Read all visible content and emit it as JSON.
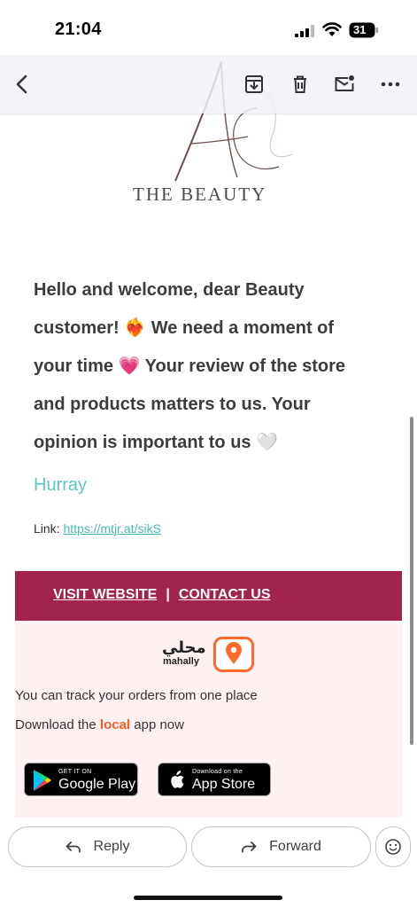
{
  "status_bar": {
    "time": "21:04",
    "battery": "31"
  },
  "toolbar": {
    "back_icon": "back-icon",
    "archive_icon": "archive-icon",
    "delete_icon": "trash-icon",
    "mark_unread_icon": "mail-unread-icon",
    "more_icon": "more-icon"
  },
  "email": {
    "logo_text": "THE BEAUTY",
    "message_line1": "Hello and welcome, dear Beauty",
    "message_line2a": "customer! ",
    "emoji_heart_fire": "❤️‍🔥",
    "message_line2b": " We need a moment of",
    "message_line3a": "your time ",
    "emoji_heart_sparkle": "💗",
    "message_line3b": " Your review of the store",
    "message_line4": "and products matters to us. Your",
    "message_line5a": "opinion is important to us ",
    "emoji_white_heart": "🤍",
    "hurray": "Hurray",
    "link_label": "Link: ",
    "link_url": "https://mtjr.at/sikS"
  },
  "footer": {
    "visit_website": "VISIT WEBSITE",
    "separator": "|",
    "contact_us": "CONTACT US",
    "brand_ar": "محلي",
    "brand_en": "mahally",
    "track_text": "You can track your orders from one place",
    "download_prefix": "Download the ",
    "download_accent": "local",
    "download_suffix": " app now",
    "google_small": "GET IT ON",
    "google_big": "Google Play",
    "apple_small": "Download on the",
    "apple_big": "App Store"
  },
  "bottom_bar": {
    "reply": "Reply",
    "forward": "Forward"
  },
  "colors": {
    "band": "#a3234f",
    "accent": "#ff5a26",
    "link": "#47b8b6",
    "hurray": "#5bc7c2"
  }
}
